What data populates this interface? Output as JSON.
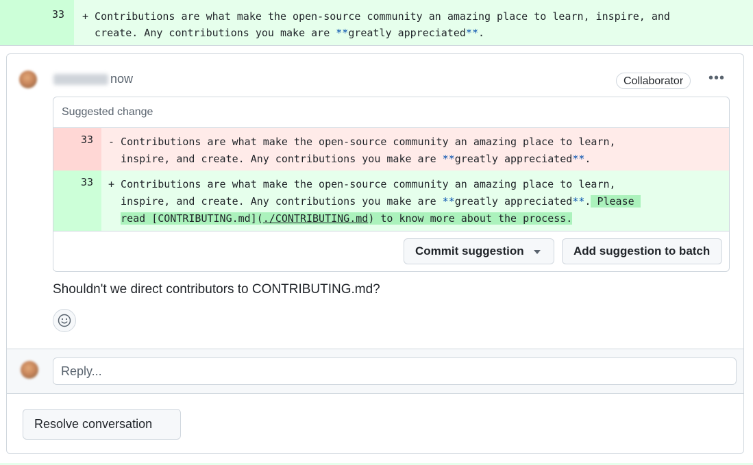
{
  "top_diff": {
    "line_number": "33",
    "line1": "+ Contributions are what make the open-source community an amazing place to learn, inspire, and",
    "line2_text": "  create. Any contributions you make are ",
    "line2_b1": "**",
    "line2_mid": "greatly appreciated",
    "line2_b2": "**",
    "line2_end": "."
  },
  "comment": {
    "timestamp": "now",
    "role_badge": "Collaborator",
    "more_icon": "kebab-horizontal-icon",
    "body": "Shouldn't we direct contributors to CONTRIBUTING.md?",
    "emoji_icon": "smiley-icon"
  },
  "suggestion": {
    "header": "Suggested change",
    "deleted": {
      "line_number": "33",
      "line1": "- Contributions are what make the open-source community an amazing place to learn,",
      "line2_a": "  inspire, and create. Any contributions you make are ",
      "line2_b1": "**",
      "line2_mid": "greatly appreciated",
      "line2_b2": "**",
      "line2_end": "."
    },
    "added": {
      "line_number": "33",
      "line1": "+ Contributions are what make the open-source community an amazing place to learn,",
      "line2_a": "  inspire, and create. Any contributions you make are ",
      "line2_b1": "**",
      "line2_mid": "greatly appreciated",
      "line2_b2": "**",
      "line2_end": ".",
      "line2_hl": " Please ",
      "line3_pre": "read [CONTRIBUTING.md](",
      "line3_link": "./CONTRIBUTING.md",
      "line3_post": ") to know more about the process."
    },
    "commit_button": "Commit suggestion",
    "batch_button": "Add suggestion to batch"
  },
  "reply": {
    "placeholder": "Reply..."
  },
  "resolve_button": "Resolve conversation",
  "colors": {
    "addition_bg": "#e6ffec",
    "addition_num_bg": "#ccffd8",
    "addition_highlight": "#abf2bc",
    "deletion_bg": "#ffebe9",
    "deletion_num_bg": "#ffd7d5",
    "border": "#d0d7de"
  }
}
